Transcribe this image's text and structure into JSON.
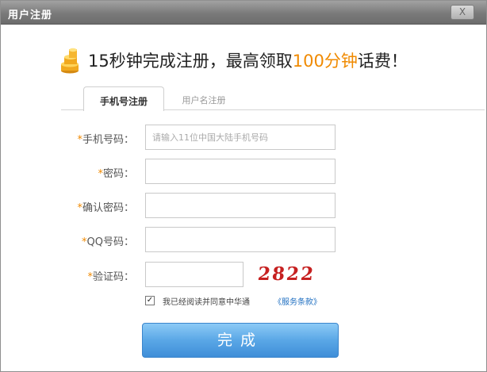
{
  "window": {
    "title": "用户注册",
    "close_label": "X"
  },
  "headline": {
    "prefix": "15秒钟完成注册，最高领取",
    "highlight": "100分钟",
    "suffix": "话费！"
  },
  "tabs": [
    {
      "label": "手机号注册",
      "active": true
    },
    {
      "label": "用户名注册",
      "active": false
    }
  ],
  "form": {
    "phone": {
      "label": "手机号码",
      "placeholder": "请输入11位中国大陆手机号码",
      "value": ""
    },
    "password": {
      "label": "密码",
      "value": ""
    },
    "confirm_password": {
      "label": "确认密码",
      "value": ""
    },
    "qq": {
      "label": "QQ号码",
      "value": ""
    },
    "captcha": {
      "label": "验证码",
      "value": "",
      "image_text": "2822"
    },
    "required_mark": "*",
    "label_colon": "："
  },
  "agreement": {
    "checked": true,
    "text": "我已经阅读并同意中华通",
    "link": "《服务条款》"
  },
  "submit_label": "完成",
  "colors": {
    "accent_orange": "#f08a00",
    "button_blue": "#4a9be0",
    "captcha_red": "#c62020"
  }
}
